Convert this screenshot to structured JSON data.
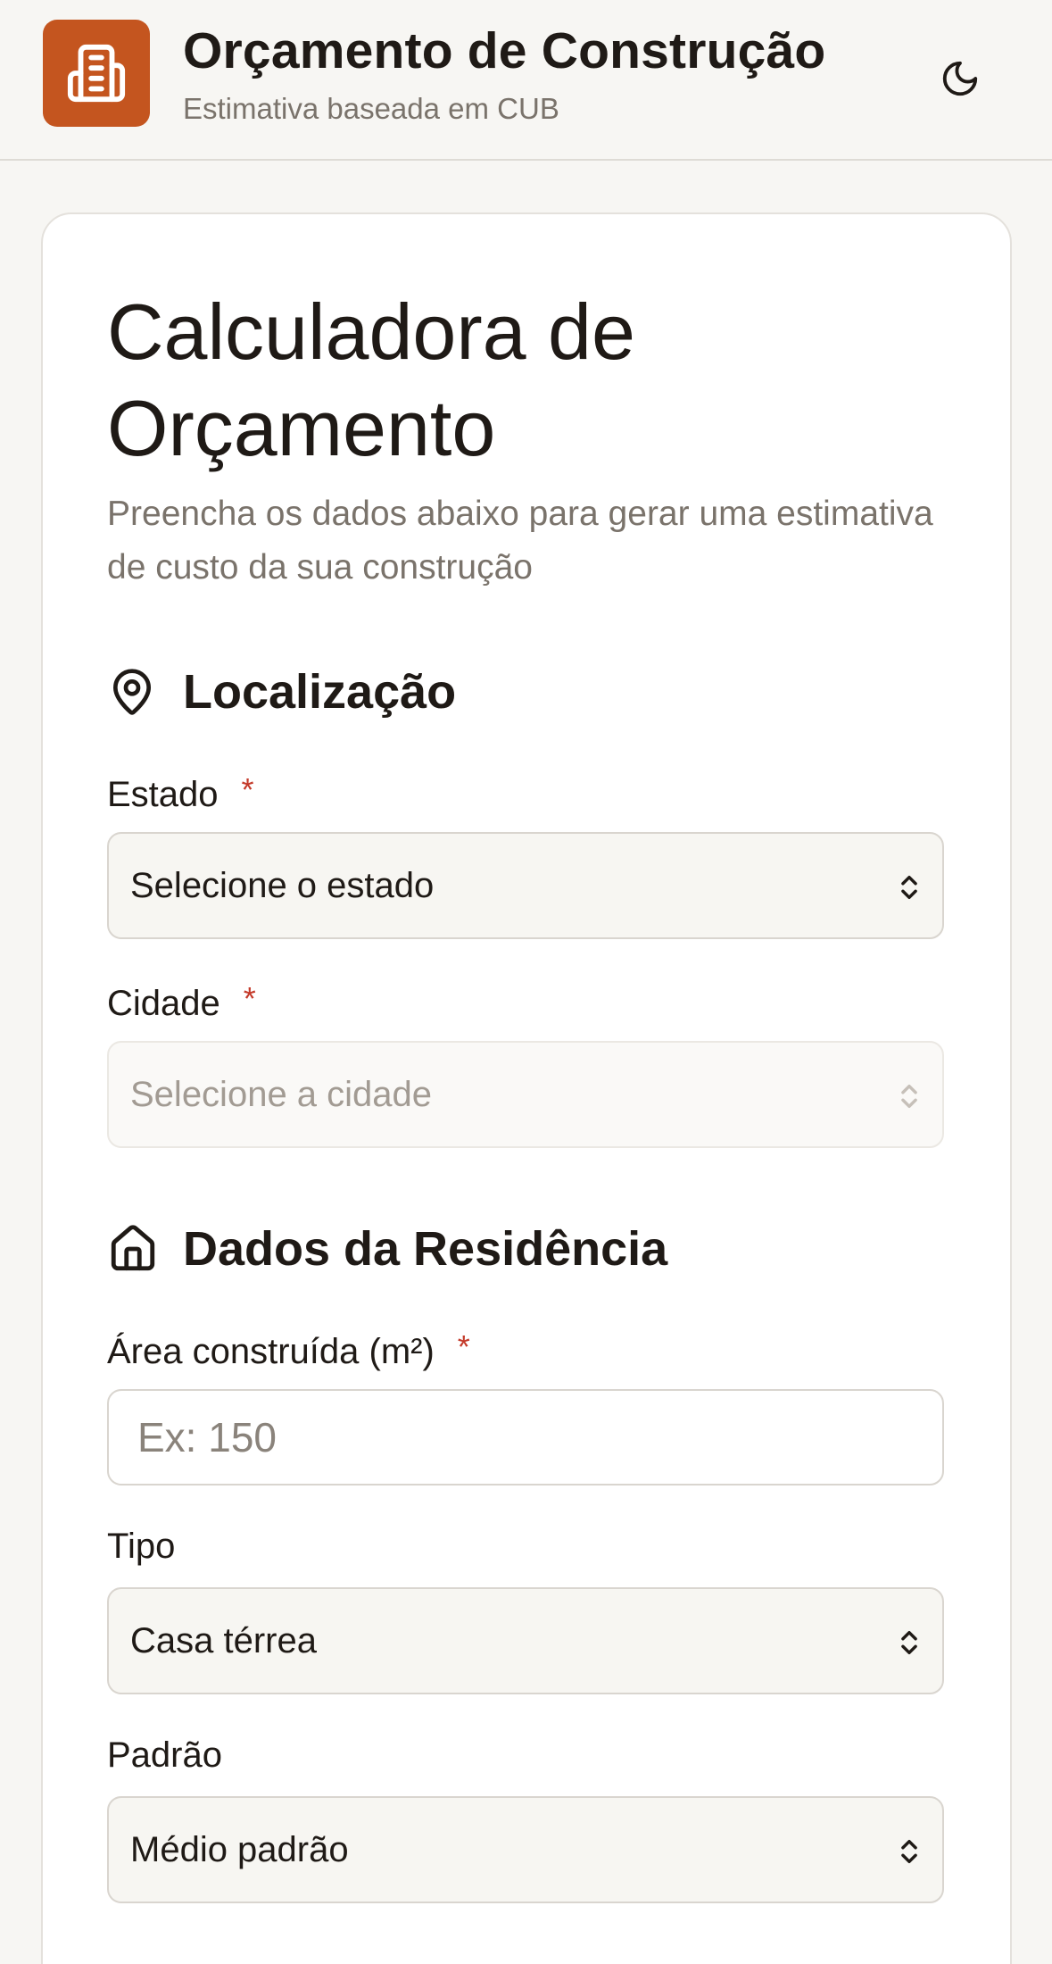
{
  "header": {
    "title": "Orçamento de Construção",
    "subtitle": "Estimativa baseada em CUB",
    "logo_icon": "building-icon",
    "theme_icon": "moon-icon",
    "accent_color": "#c4551f"
  },
  "card": {
    "title": "Calculadora de Orçamento",
    "description": "Preencha os dados abaixo para gerar uma estimativa de custo da sua construção"
  },
  "location": {
    "heading": "Localização",
    "icon": "map-pin-icon",
    "state": {
      "label": "Estado",
      "required_mark": "*",
      "value": "Selecione o estado"
    },
    "city": {
      "label": "Cidade",
      "required_mark": "*",
      "value": "Selecione a cidade",
      "disabled": true
    }
  },
  "residence": {
    "heading": "Dados da Residência",
    "icon": "home-icon",
    "area": {
      "label": "Área construída (m²)",
      "required_mark": "*",
      "placeholder": "Ex: 150",
      "value": ""
    },
    "type": {
      "label": "Tipo",
      "value": "Casa térrea"
    },
    "standard": {
      "label": "Padrão",
      "value": "Médio padrão"
    }
  }
}
